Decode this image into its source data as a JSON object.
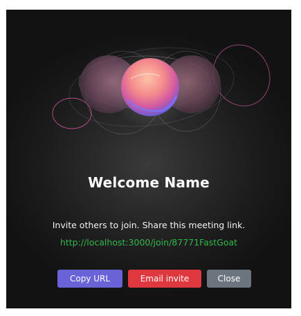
{
  "modal": {
    "title": "Welcome Name",
    "subtitle": "Invite others to join. Share this meeting link.",
    "meeting_link": "http://localhost:3000/join/87771FastGoat"
  },
  "buttons": {
    "copy_url": "Copy URL",
    "email_invite": "Email invite",
    "close": "Close"
  },
  "colors": {
    "copy_button": "#6a63d8",
    "email_button": "#e0383f",
    "close_button": "#6c757d",
    "link": "#2fb84a",
    "background": "#1b1b1b"
  }
}
